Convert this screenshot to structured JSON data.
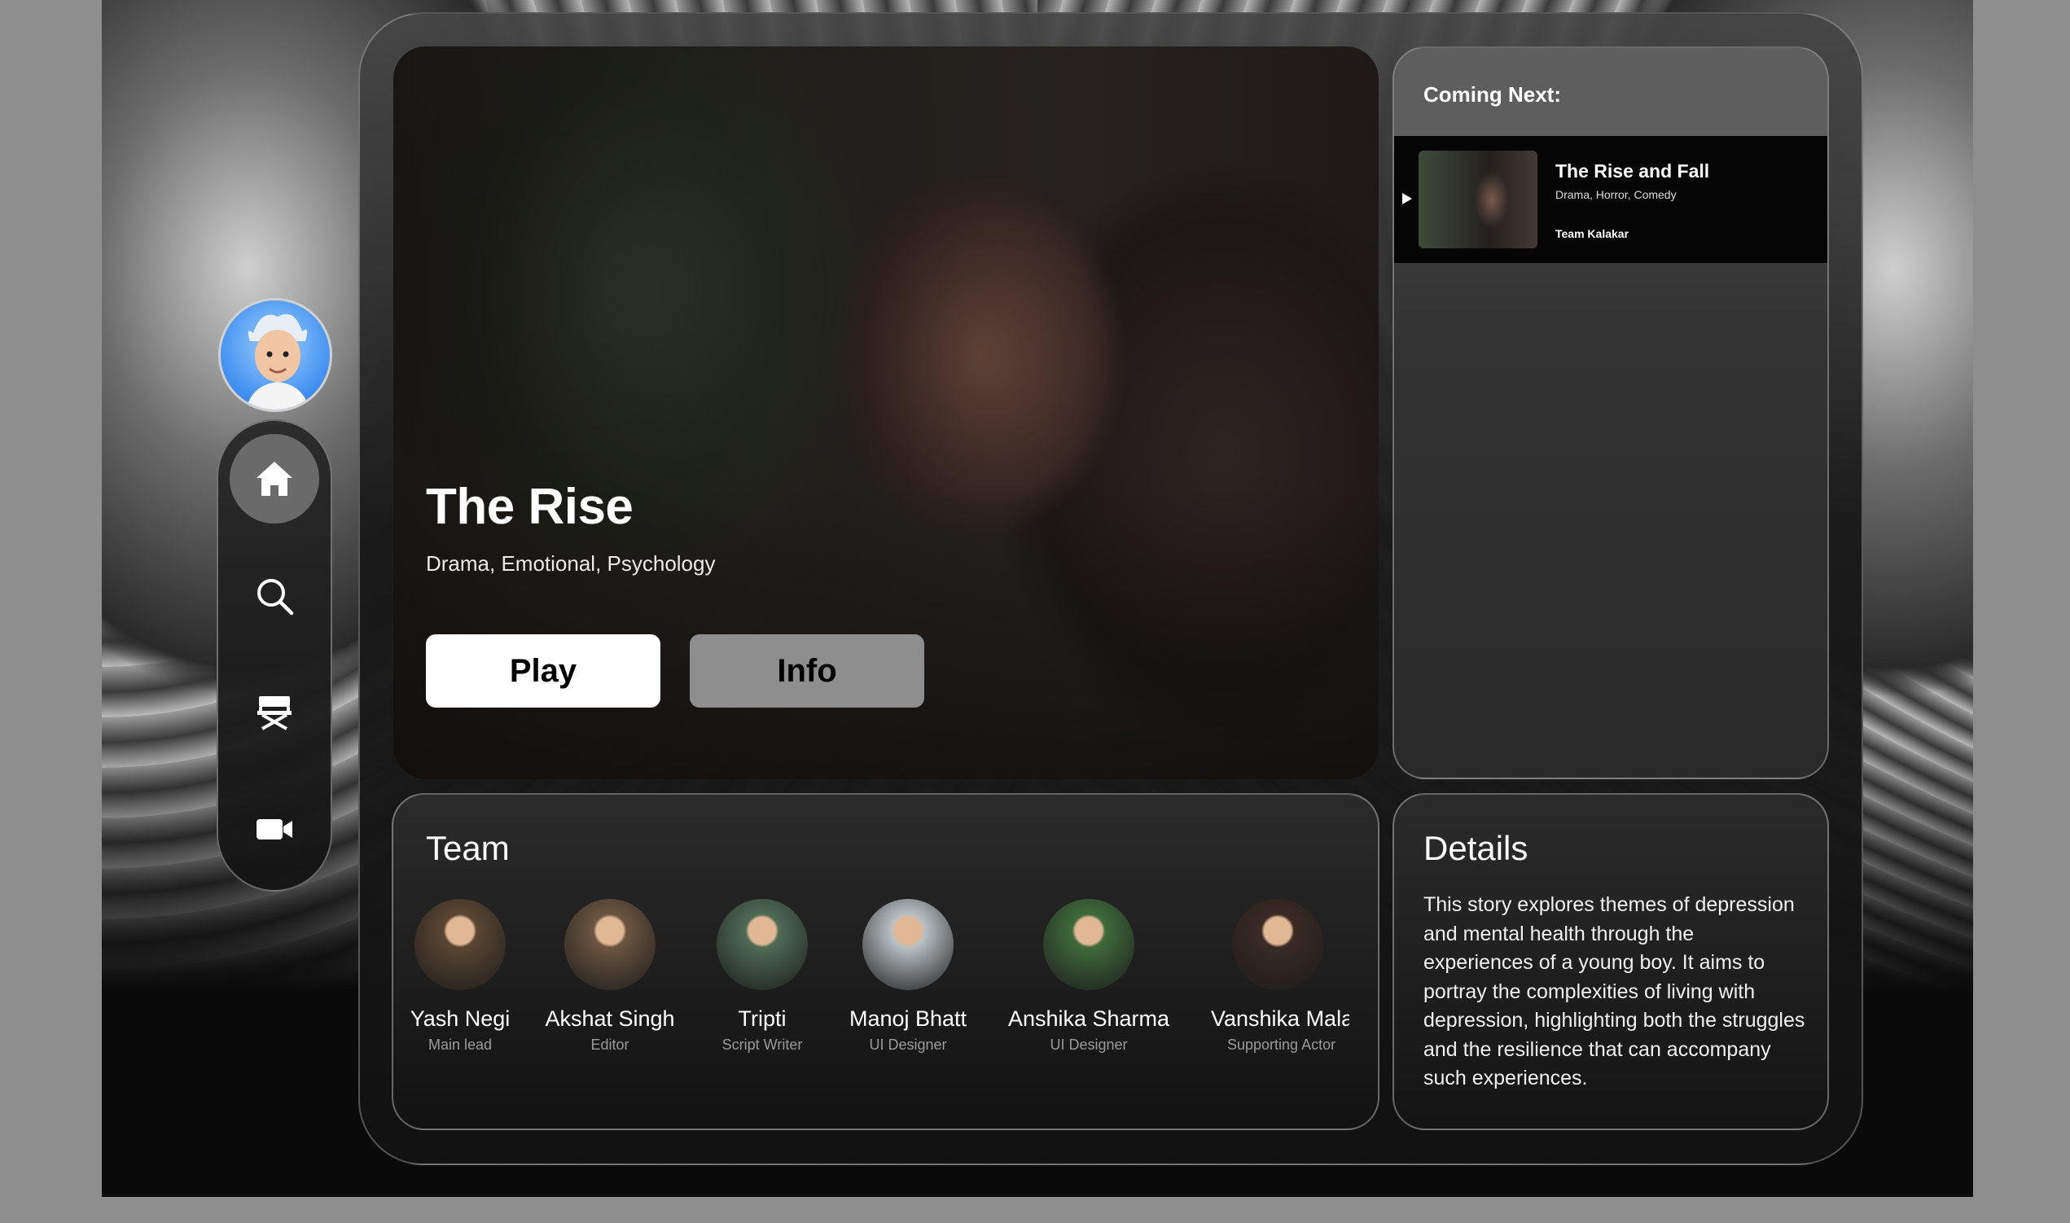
{
  "sidebar": {
    "avatar_icon": "avatar-icon",
    "items": [
      {
        "icon": "home-icon",
        "active": true
      },
      {
        "icon": "search-icon",
        "active": false
      },
      {
        "icon": "director-chair-icon",
        "active": false
      },
      {
        "icon": "video-camera-icon",
        "active": false
      }
    ]
  },
  "hero": {
    "title": "The Rise",
    "genres": "Drama, Emotional, Psychology",
    "play_label": "Play",
    "info_label": "Info"
  },
  "coming_next": {
    "heading": "Coming Next:",
    "item": {
      "title": "The Rise and Fall",
      "genres": "Drama, Horror, Comedy",
      "team": "Team Kalakar",
      "icon": "play-icon"
    }
  },
  "team": {
    "heading": "Team",
    "members": [
      {
        "name": "Yash Negi",
        "role": "Main lead",
        "color": "#5a4632"
      },
      {
        "name": "Akshat Singh",
        "role": "Editor",
        "color": "#6b5540"
      },
      {
        "name": "Tripti",
        "role": "Script Writer",
        "color": "#4f6b55"
      },
      {
        "name": "Manoj Bhatt",
        "role": "UI Designer",
        "color": "#b9c0c4"
      },
      {
        "name": "Anshika Sharma",
        "role": "UI Designer",
        "color": "#3f6a3a"
      },
      {
        "name": "Vanshika Mala",
        "role": "Supporting Actor",
        "color": "#3a2a24"
      }
    ]
  },
  "details": {
    "heading": "Details",
    "text": "This story explores themes of depression and mental health through the experiences of a young boy. It aims to portray the complexities of living with depression, highlighting both the struggles and the resilience that can accompany such experiences."
  }
}
